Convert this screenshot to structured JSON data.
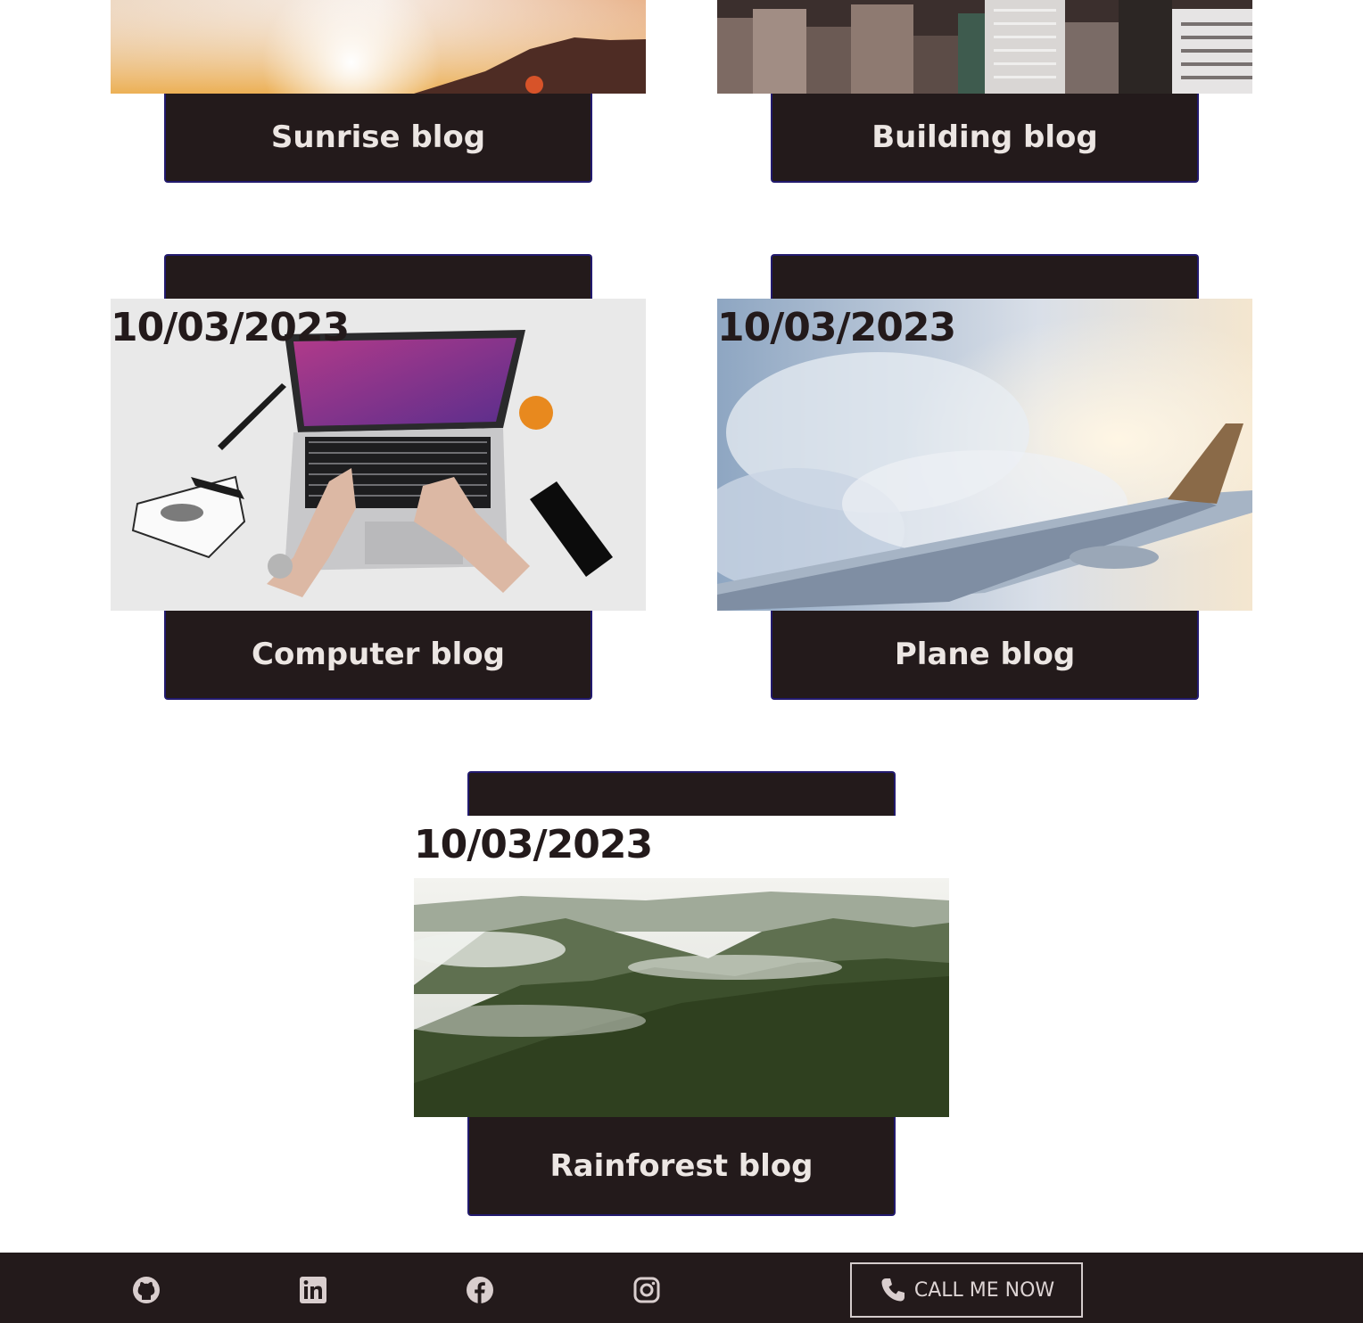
{
  "posts": [
    {
      "title": "Sunrise blog",
      "image_icon": "sunrise-photo"
    },
    {
      "title": "Building blog",
      "image_icon": "city-buildings-photo"
    },
    {
      "date": "10/03/2023",
      "title": "Computer blog",
      "image_icon": "laptop-desk-photo"
    },
    {
      "date": "10/03/2023",
      "title": "Plane blog",
      "image_icon": "airplane-wing-photo"
    },
    {
      "date": "10/03/2023",
      "title": "Rainforest blog",
      "image_icon": "forest-hills-photo"
    }
  ],
  "footer": {
    "social_icons": [
      "github-icon",
      "linkedin-icon",
      "facebook-icon",
      "instagram-icon"
    ],
    "call_label": "CALL ME NOW"
  },
  "colors": {
    "card": "#231a1b",
    "card_border": "#221a6e",
    "card_text": "#ece6e3",
    "footer_text": "#ddd4d4"
  }
}
